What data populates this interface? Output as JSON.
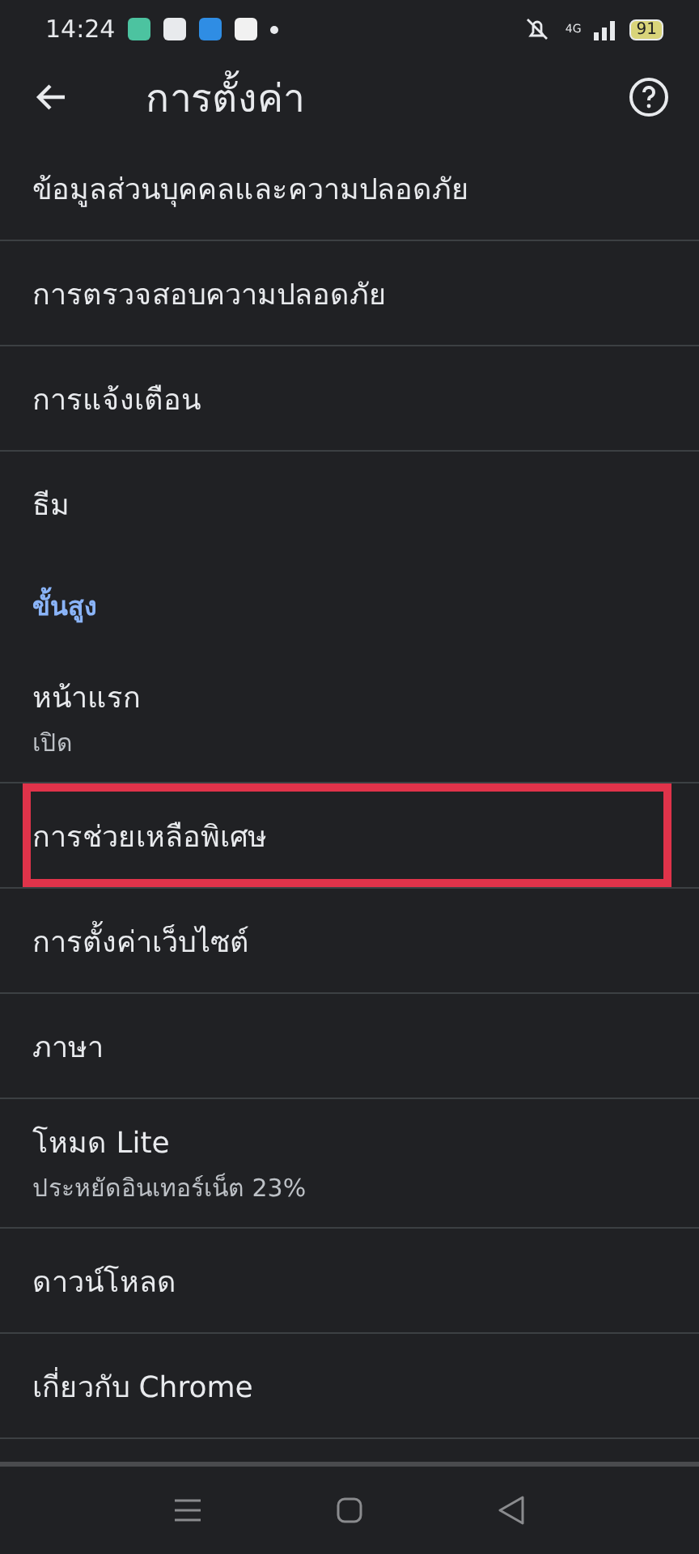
{
  "status_bar": {
    "time": "14:24",
    "network": "4G",
    "battery": "91"
  },
  "app_bar": {
    "title": "การตั้งค่า"
  },
  "items": [
    {
      "kind": "item",
      "title": "ข้อมูลส่วนบุคคลและความปลอดภัย",
      "highlighted": false
    },
    {
      "kind": "item",
      "title": "การตรวจสอบความปลอดภัย",
      "highlighted": false
    },
    {
      "kind": "item",
      "title": "การแจ้งเตือน",
      "highlighted": false
    },
    {
      "kind": "item",
      "title": "ธีม",
      "highlighted": false
    },
    {
      "kind": "section",
      "title": "ขั้นสูง"
    },
    {
      "kind": "item",
      "title": "หน้าแรก",
      "subtitle": "เปิด",
      "highlighted": false
    },
    {
      "kind": "item",
      "title": "การช่วยเหลือพิเศษ",
      "highlighted": true
    },
    {
      "kind": "item",
      "title": "การตั้งค่าเว็บไซต์",
      "highlighted": false
    },
    {
      "kind": "item",
      "title": "ภาษา",
      "highlighted": false
    },
    {
      "kind": "item",
      "title": "โหมด Lite",
      "subtitle": "ประหยัดอินเทอร์เน็ต 23%",
      "highlighted": false
    },
    {
      "kind": "item",
      "title": "ดาวน์โหลด",
      "highlighted": false
    },
    {
      "kind": "item",
      "title": "เกี่ยวกับ Chrome",
      "highlighted": false
    }
  ]
}
